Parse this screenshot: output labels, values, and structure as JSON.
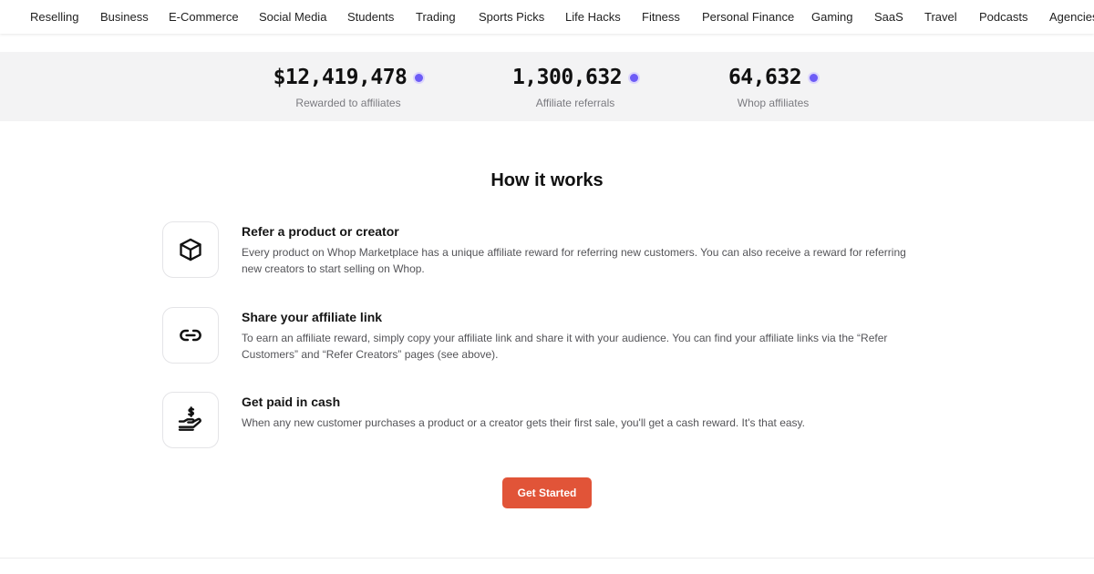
{
  "nav": {
    "items": [
      "Reselling",
      "Business",
      "E-Commerce",
      "Social Media",
      "Students",
      "Trading",
      "Sports Picks",
      "Life Hacks",
      "Fitness",
      "Personal Finance",
      "Gaming",
      "SaaS",
      "Travel",
      "Podcasts",
      "Agencies"
    ]
  },
  "stats": [
    {
      "value": "$12,419,478",
      "label": "Rewarded to affiliates"
    },
    {
      "value": "1,300,632",
      "label": "Affiliate referrals"
    },
    {
      "value": "64,632",
      "label": "Whop affiliates"
    }
  ],
  "how_it_works": {
    "title": "How it works",
    "steps": [
      {
        "icon": "box-icon",
        "title": "Refer a product or creator",
        "description": "Every product on Whop Marketplace has a unique affiliate reward for referring new customers. You can also receive a reward for referring new creators to start selling on Whop."
      },
      {
        "icon": "link-icon",
        "title": "Share your affiliate link",
        "description": "To earn an affiliate reward, simply copy your affiliate link and share it with your audience. You can find your affiliate links via the “Refer Customers” and “Refer Creators” pages (see above)."
      },
      {
        "icon": "hand-dollar-icon",
        "title": "Get paid in cash",
        "description": "When any new customer purchases a product or a creator gets their first sale, you'll get a cash reward. It's that easy."
      }
    ]
  },
  "cta": {
    "label": "Get Started"
  },
  "colors": {
    "accent": "#e15438",
    "indicator": "#6d5cf6",
    "stats_background": "#f3f3f4"
  }
}
